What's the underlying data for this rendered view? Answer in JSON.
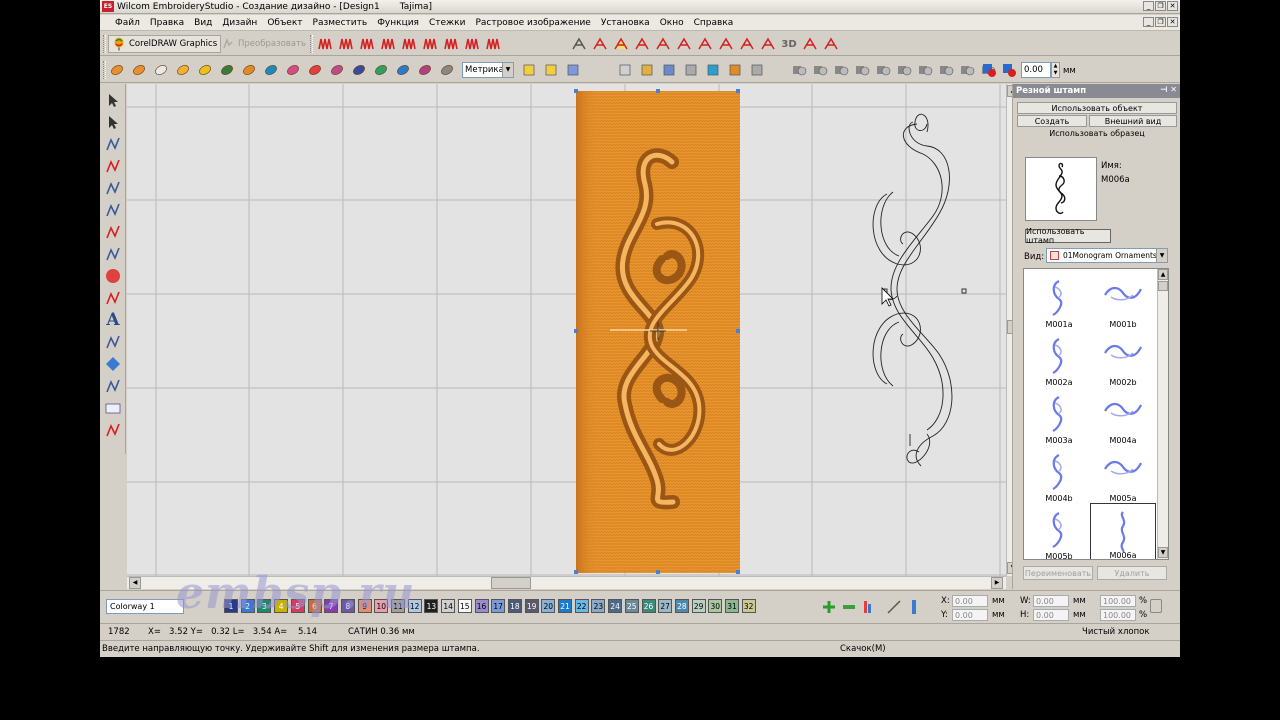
{
  "window": {
    "icon_text": "ES",
    "title": "Wilcom EmbroideryStudio - Создание дизайно - [Design1       Tajima]"
  },
  "menu": [
    "Файл",
    "Правка",
    "Вид",
    "Дизайн",
    "Объект",
    "Разместить",
    "Функция",
    "Стежки",
    "Растровое изображение",
    "Установка",
    "Окно",
    "Справка"
  ],
  "toolbar": {
    "corel_label": "CorelDRAW Graphics",
    "convert_label": "Преобразовать",
    "units_select": "Метрика",
    "angle_value": "0.00",
    "angle_unit": "мм"
  },
  "docker": {
    "title": "Резной штамп",
    "tab_use_object": "Использовать объект",
    "tab_create": "Создать",
    "tab_appearance": "Внешний вид",
    "tab_use_sample": "Использовать образец",
    "name_label": "Имя:",
    "name_value": "M006a",
    "use_stamp_button": "Использовать штамп",
    "view_label": "Вид:",
    "view_value": "01Monogram Ornaments",
    "gallery": [
      "M001a",
      "M001b",
      "M002a",
      "M002b",
      "M003a",
      "M004a",
      "M004b",
      "M005a",
      "M005b",
      "M006a"
    ],
    "selected": "M006a",
    "rename_button": "Переименовать",
    "delete_button": "Удалить"
  },
  "colorbar": {
    "colorway": "Colorway 1",
    "swatches": [
      {
        "n": "1",
        "c": "#2a3a8a"
      },
      {
        "n": "2",
        "c": "#3a7ad0"
      },
      {
        "n": "3",
        "c": "#1a8a6a"
      },
      {
        "n": "4",
        "c": "#c8b400"
      },
      {
        "n": "5",
        "c": "#d83a60"
      },
      {
        "n": "6",
        "c": "#d06a30"
      },
      {
        "n": "7",
        "c": "#8a3ab0"
      },
      {
        "n": "8",
        "c": "#6a5aa0"
      },
      {
        "n": "9",
        "c": "#e09070"
      },
      {
        "n": "10",
        "c": "#e8a0b0"
      },
      {
        "n": "11",
        "c": "#a0a0a0"
      },
      {
        "n": "12",
        "c": "#b0c8e8"
      },
      {
        "n": "13",
        "c": "#202020"
      },
      {
        "n": "14",
        "c": "#d0d0d0"
      },
      {
        "n": "15",
        "c": "#f8f8f8"
      },
      {
        "n": "16",
        "c": "#9a8ad0"
      },
      {
        "n": "17",
        "c": "#7a9ad8"
      },
      {
        "n": "18",
        "c": "#4a5a78"
      },
      {
        "n": "19",
        "c": "#5a5a6a"
      },
      {
        "n": "20",
        "c": "#8ab0d8"
      },
      {
        "n": "21",
        "c": "#1a7ad0"
      },
      {
        "n": "22",
        "c": "#6ab8e8"
      },
      {
        "n": "23",
        "c": "#8aa8c8"
      },
      {
        "n": "24",
        "c": "#4a6a8a"
      },
      {
        "n": "25",
        "c": "#6a8a9a"
      },
      {
        "n": "26",
        "c": "#3a8a7a"
      },
      {
        "n": "27",
        "c": "#9ab8c8"
      },
      {
        "n": "28",
        "c": "#4a8ab0"
      },
      {
        "n": "29",
        "c": "#b8d0c0"
      },
      {
        "n": "30",
        "c": "#a8c8a0"
      },
      {
        "n": "31",
        "c": "#8ab890"
      },
      {
        "n": "32",
        "c": "#c8c890"
      }
    ],
    "x_label": "X:",
    "x_value": "0.00",
    "y_label": "Y:",
    "y_value": "0.00",
    "w_label": "W:",
    "w_value": "0.00",
    "h_label": "H:",
    "h_value": "0.00",
    "unit": "мм",
    "pct1": "100.00",
    "pct2": "100.00",
    "pct_unit": "%"
  },
  "status": {
    "stitch_count": "1782",
    "coords": "X=   3.52 Y=   0.32 L=   3.54 A=    5.14",
    "stitch_type": "САТИН 0.36 мм",
    "fabric": "Чистый хлопок",
    "hint": "Введите направляющую точку. Удерживайте Shift для изменения размера штампа.",
    "jump": "Скачок(M)"
  },
  "watermark": "embsp.ru",
  "colors": {
    "embroidery": "#e8952e",
    "embroidery_dark": "#a9621b",
    "selection_handle": "#4a7fd8"
  }
}
